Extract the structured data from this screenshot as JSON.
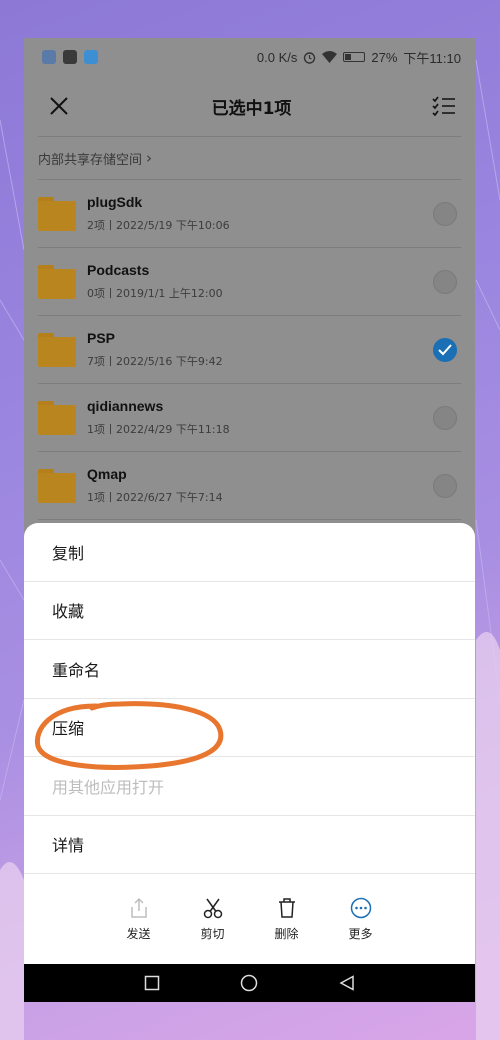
{
  "status_bar": {
    "network_speed": "0.0 K/s",
    "battery": "27%",
    "time": "下午11:10",
    "icons": [
      "app-icon-1",
      "camera-app-icon",
      "app-icon-3",
      "alarm-icon",
      "wifi-icon",
      "battery-icon"
    ]
  },
  "header": {
    "title": "已选中1项",
    "close_icon": "close-icon",
    "select_all_icon": "select-all-icon"
  },
  "breadcrumb": {
    "label": "内部共享存储空间",
    "chevron": "›"
  },
  "files": [
    {
      "name": "plugSdk",
      "meta": "2项丨2022/5/19 下午10:06",
      "selected": false
    },
    {
      "name": "Podcasts",
      "meta": "0项丨2019/1/1 上午12:00",
      "selected": false
    },
    {
      "name": "PSP",
      "meta": "7项丨2022/5/16 下午9:42",
      "selected": true
    },
    {
      "name": "qidiannews",
      "meta": "1项丨2022/4/29 下午11:18",
      "selected": false
    },
    {
      "name": "Qmap",
      "meta": "1项丨2022/6/27 下午7:14",
      "selected": false
    }
  ],
  "menu": [
    {
      "label": "复制",
      "enabled": true
    },
    {
      "label": "收藏",
      "enabled": true
    },
    {
      "label": "重命名",
      "enabled": true
    },
    {
      "label": "压缩",
      "enabled": true
    },
    {
      "label": "用其他应用打开",
      "enabled": false
    },
    {
      "label": "详情",
      "enabled": true
    }
  ],
  "actions": [
    {
      "label": "发送",
      "icon": "share-icon",
      "enabled": false
    },
    {
      "label": "剪切",
      "icon": "scissors-icon",
      "enabled": true
    },
    {
      "label": "删除",
      "icon": "trash-icon",
      "enabled": true
    },
    {
      "label": "更多",
      "icon": "more-icon",
      "enabled": true
    }
  ],
  "colors": {
    "accent": "#1a6fb5",
    "annotation": "#e8762f",
    "folder": "#b9851f"
  }
}
